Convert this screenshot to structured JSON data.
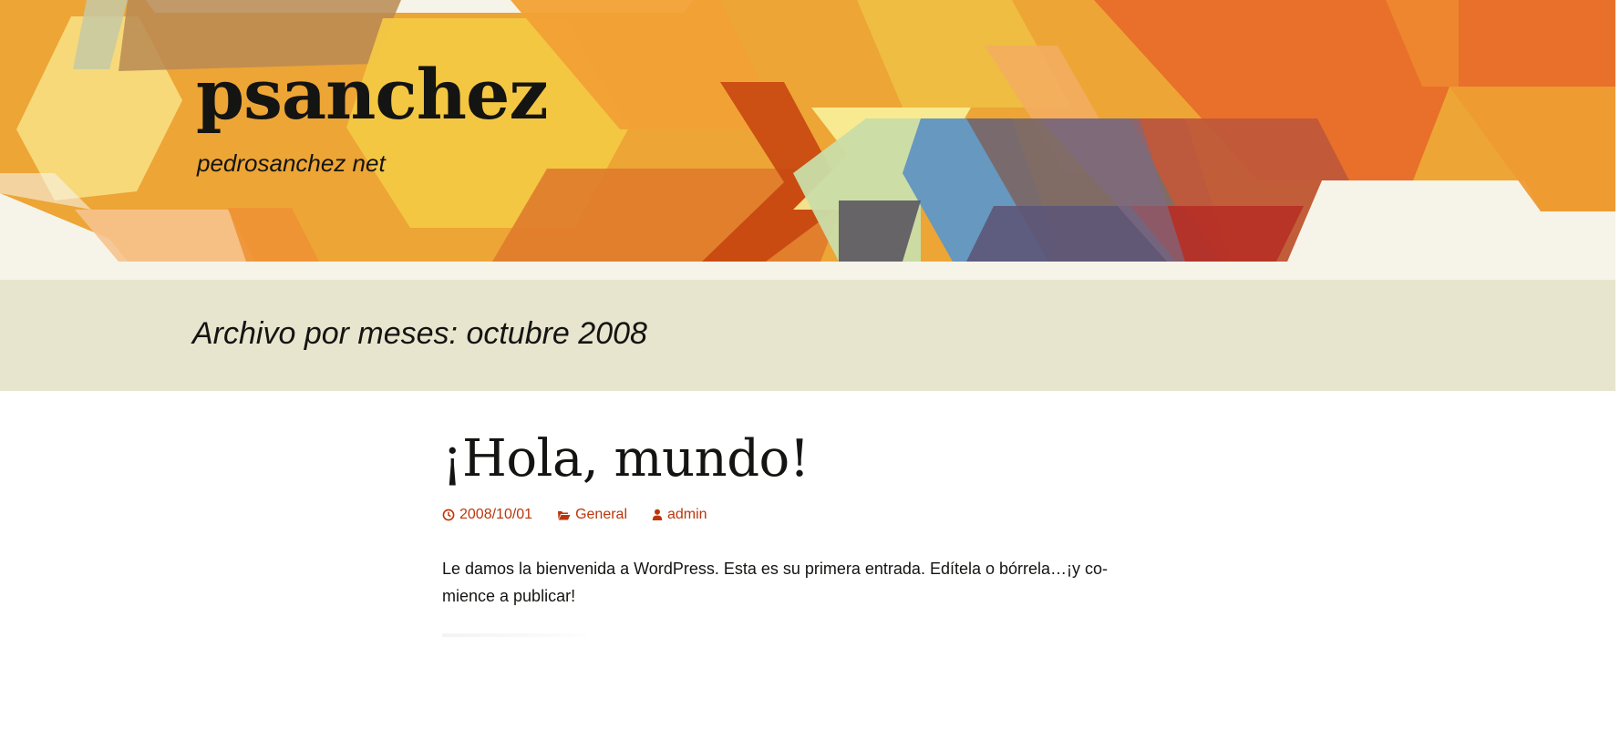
{
  "site": {
    "title": "psanchez",
    "description": "pedrosanchez net"
  },
  "archive": {
    "title": "Archivo por meses: octubre 2008"
  },
  "post": {
    "title": "¡Hola, mundo!",
    "date": "2008/10/01",
    "category": "General",
    "author": "admin",
    "content_line_1": "Le damos la bienvenida a WordPress. Esta es su primera entrada. Edítela o bórrela…¡y co-",
    "content_line_2": "mience a publicar!"
  },
  "icons": {
    "date": "clock-icon",
    "category": "folder-icon",
    "author": "user-icon"
  },
  "colors": {
    "header_background": "#f6f4e9",
    "archive_band": "#e8e5ce",
    "link": "#bc360a",
    "text": "#141412"
  }
}
